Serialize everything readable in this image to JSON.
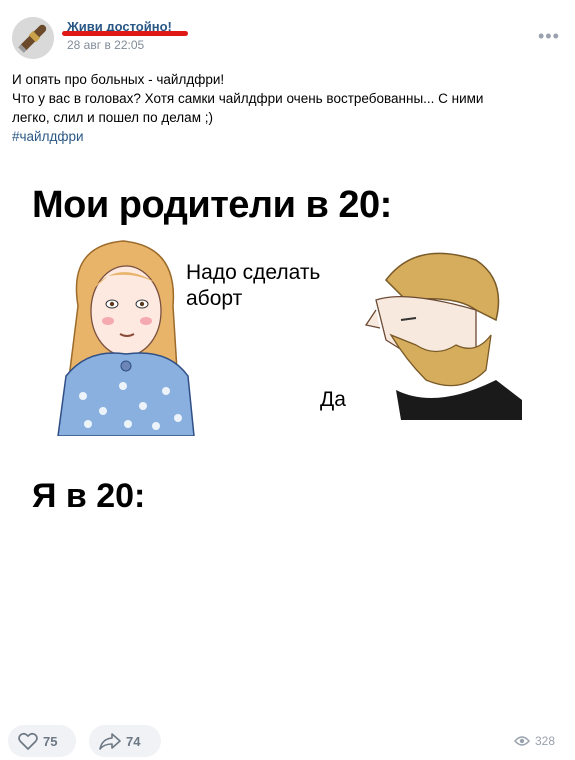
{
  "post": {
    "author": "Живи достойно!",
    "date": "28 авг в 22:05",
    "more_icon": "more-dots-icon",
    "text_lines": [
      "И опять про больных - чайлдфри!",
      "Что у вас в головах? Хотя самки чайлдфри очень востребованны... С ними",
      "легко, слил и пошел по делам ;)"
    ],
    "hashtag": "#чайлдфри"
  },
  "meme": {
    "title1": "Мои родители в 20:",
    "speech_girl_line1": "Надо сделать",
    "speech_girl_line2": "аборт",
    "speech_man": "Да",
    "title2": "Я в 20:"
  },
  "footer": {
    "likes": "75",
    "shares": "74",
    "views": "328",
    "like_icon": "heart-icon",
    "share_icon": "share-arrow-icon",
    "views_icon": "eye-icon"
  },
  "colors": {
    "link": "#2a5885",
    "secondary": "#818c99",
    "underline": "#e01818"
  }
}
